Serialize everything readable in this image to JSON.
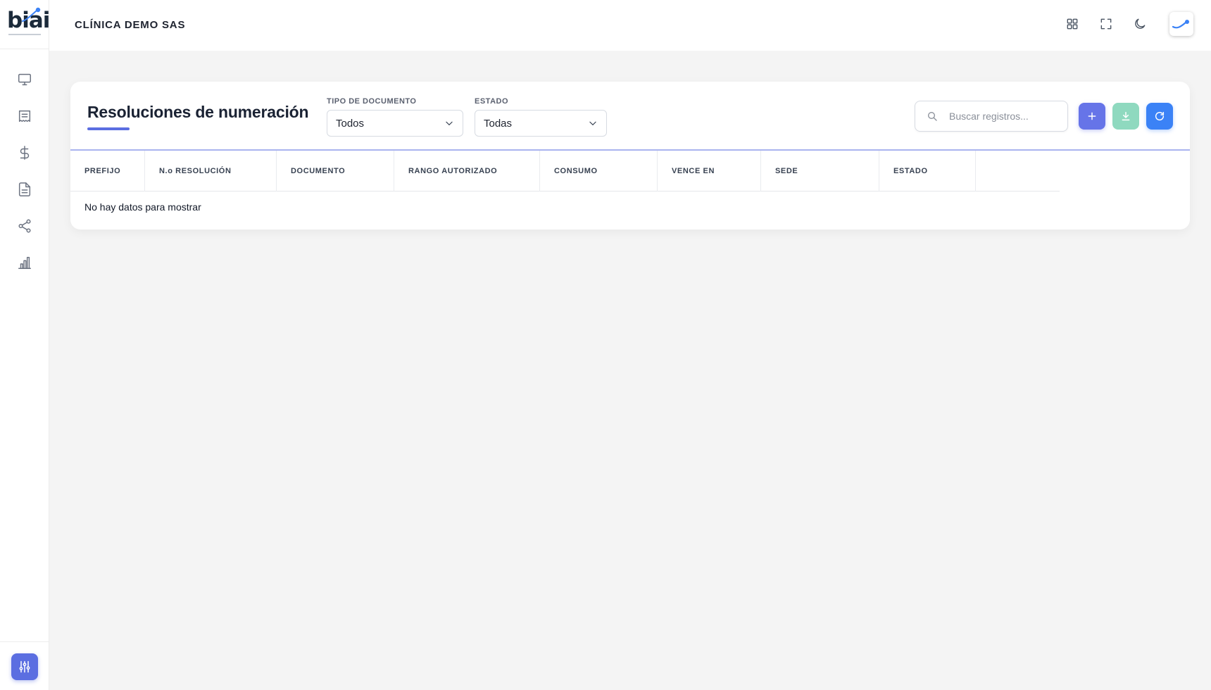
{
  "brand": {
    "logo_text": "biai",
    "accent": "#5b6ee1"
  },
  "header": {
    "company": "CLÍNICA DEMO SAS"
  },
  "sidebar": {
    "items": [
      {
        "icon": "monitor-icon"
      },
      {
        "icon": "receipt-icon"
      },
      {
        "icon": "dollar-icon"
      },
      {
        "icon": "document-icon"
      },
      {
        "icon": "share-icon"
      },
      {
        "icon": "bar-chart-icon"
      }
    ],
    "settings_icon": "sliders-icon"
  },
  "page": {
    "title": "Resoluciones de numeración"
  },
  "filters": {
    "document_type": {
      "label": "TIPO DE DOCUMENTO",
      "value": "Todos"
    },
    "status": {
      "label": "ESTADO",
      "value": "Todas"
    }
  },
  "search": {
    "placeholder": "Buscar registros..."
  },
  "table": {
    "columns": [
      "PREFIJO",
      "N.o RESOLUCIÓN",
      "DOCUMENTO",
      "RANGO AUTORIZADO",
      "CONSUMO",
      "VENCE EN",
      "SEDE",
      "ESTADO"
    ],
    "empty_text": "No hay datos para mostrar"
  }
}
